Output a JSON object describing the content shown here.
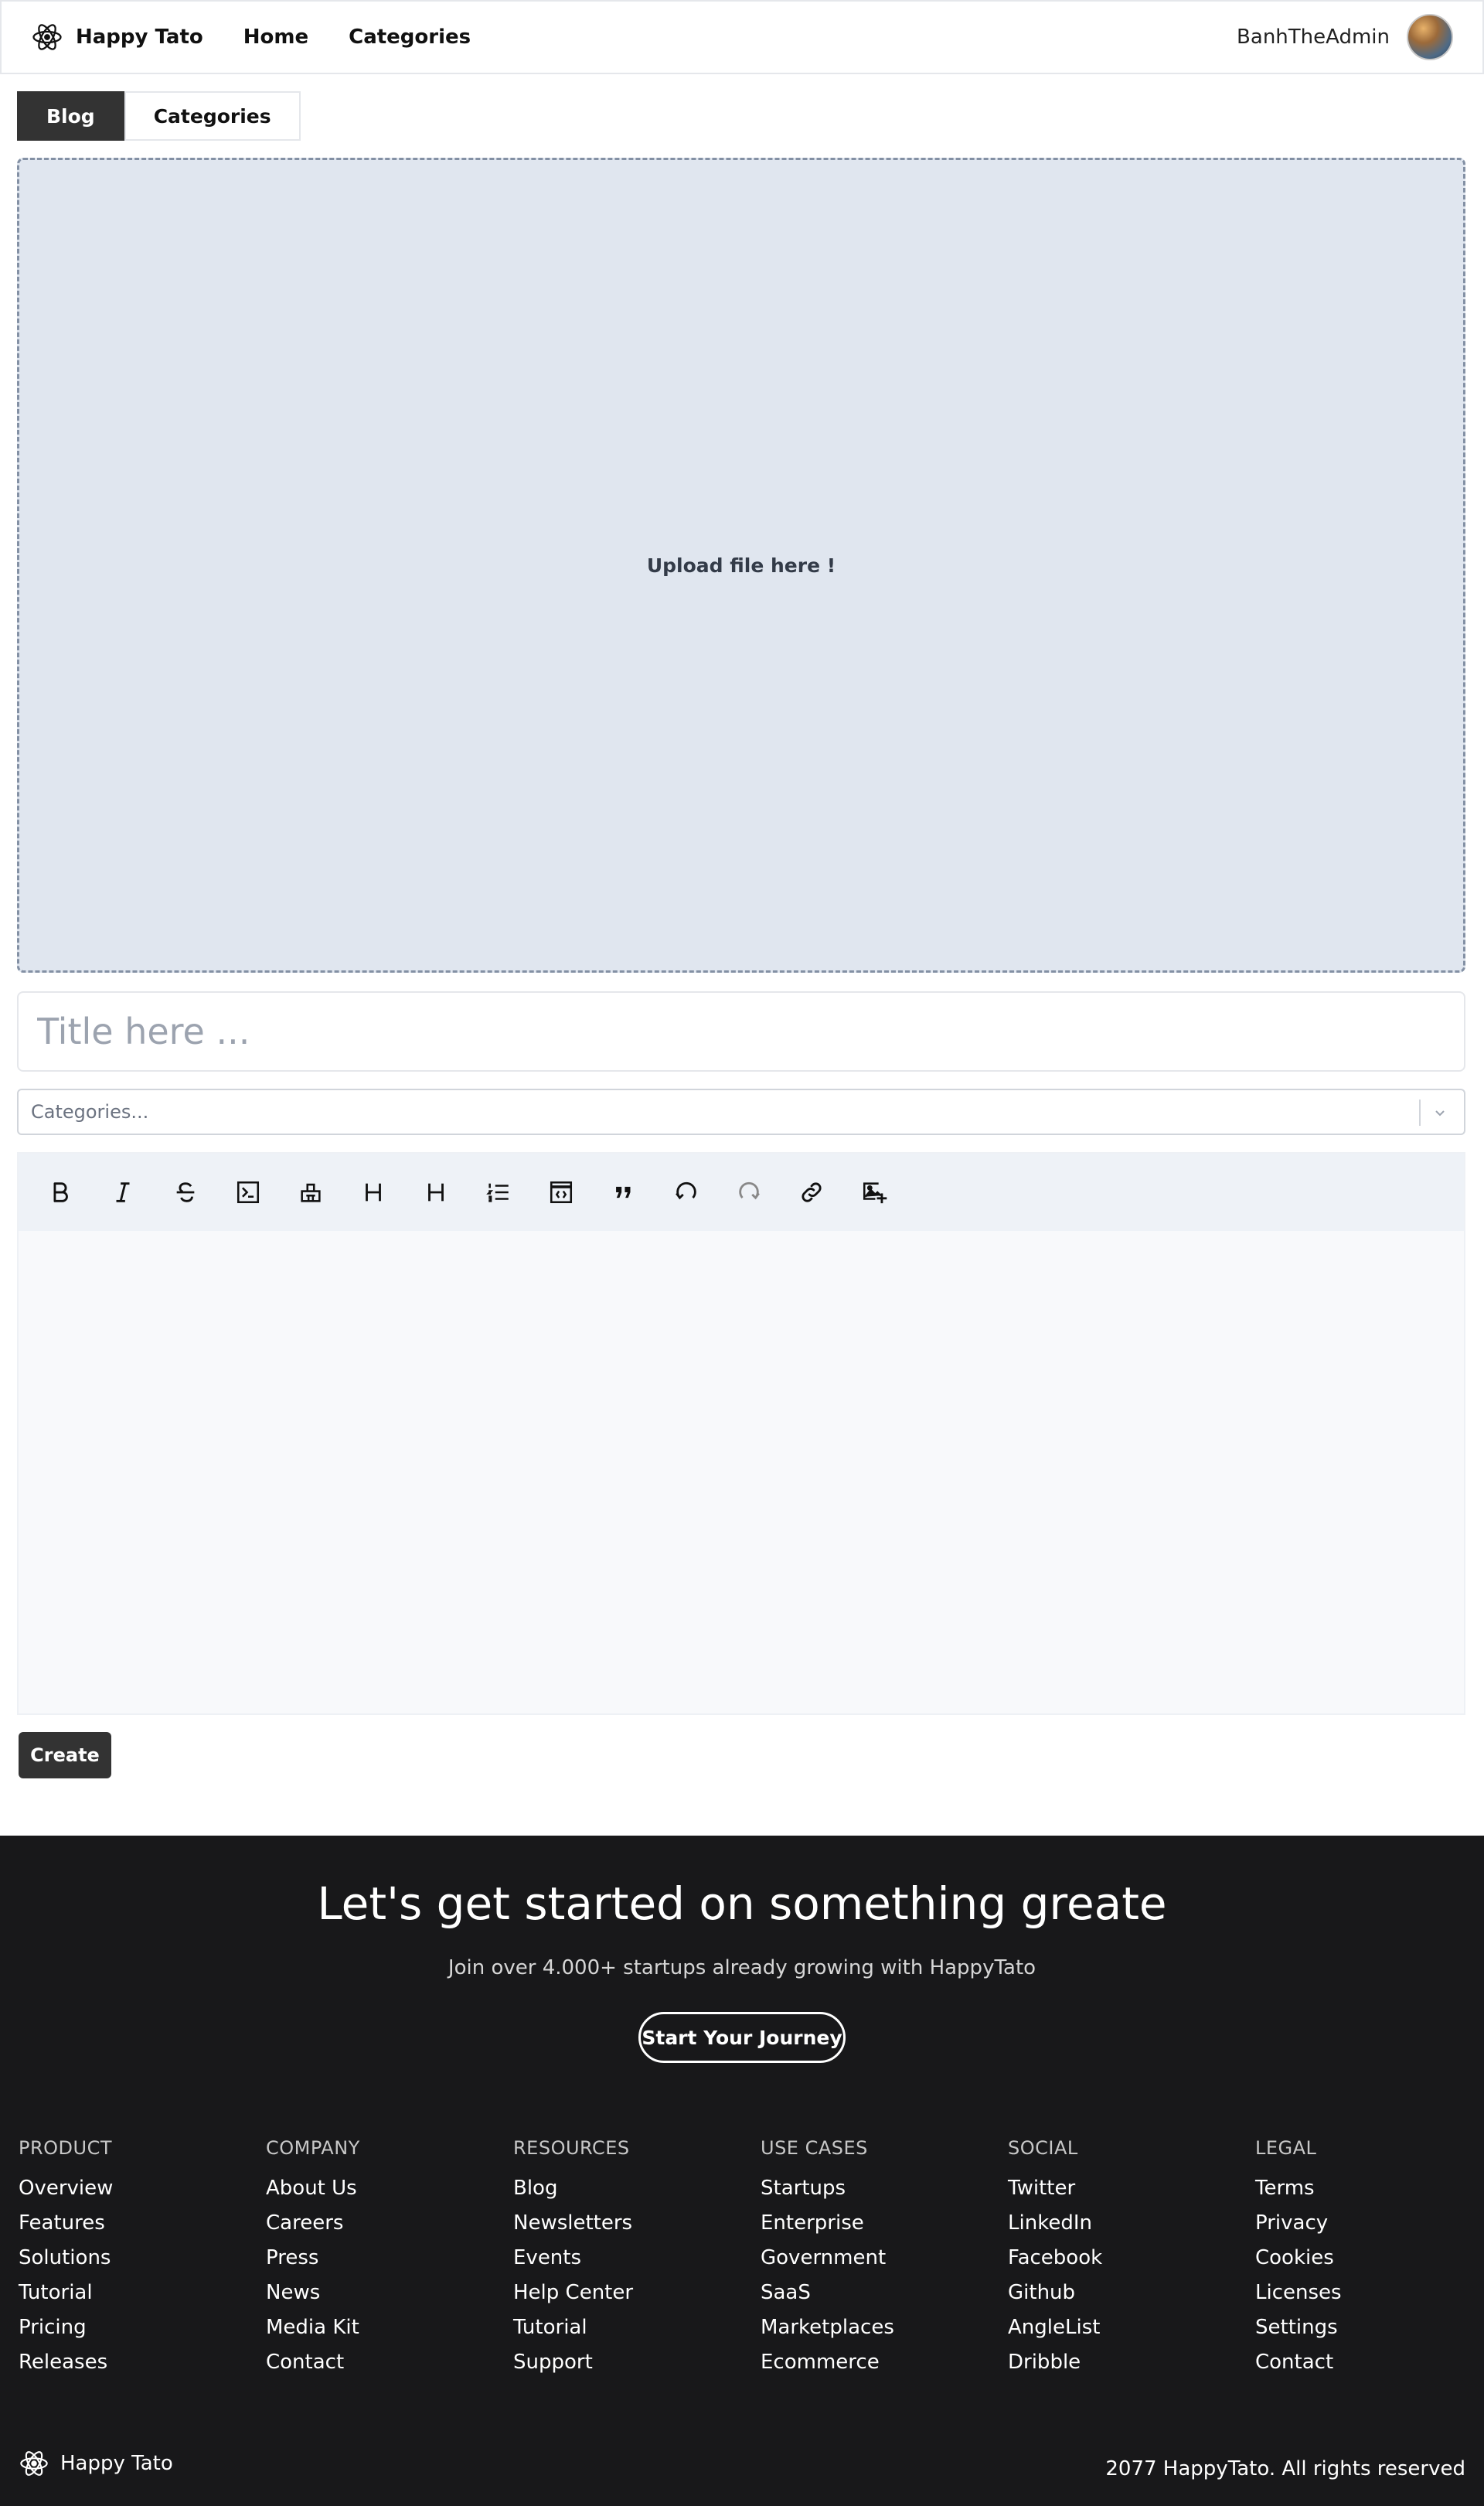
{
  "header": {
    "brand": "Happy Tato",
    "nav": [
      "Home",
      "Categories"
    ],
    "username": "BanhTheAdmin"
  },
  "tabs": [
    {
      "label": "Blog",
      "active": true
    },
    {
      "label": "Categories",
      "active": false
    }
  ],
  "upload": {
    "text": "Upload file here !"
  },
  "title_input": {
    "placeholder": "Title here ...",
    "value": ""
  },
  "categories_select": {
    "placeholder": "Categories..."
  },
  "toolbar": {
    "icons": [
      "bold-icon",
      "italic-icon",
      "strikethrough-icon",
      "code-icon",
      "clear-format-icon",
      "heading-1-icon",
      "heading-2-icon",
      "ordered-list-icon",
      "code-block-icon",
      "quote-icon",
      "undo-icon",
      "redo-icon",
      "link-icon",
      "add-image-icon"
    ]
  },
  "create_button": "Create",
  "footer": {
    "cta_title": "Let's get started on something greate",
    "cta_subtitle": "Join over 4.000+ startups already growing with HappyTato",
    "cta_button": "Start Your Journey",
    "columns": [
      {
        "heading": "PRODUCT",
        "links": [
          "Overview",
          "Features",
          "Solutions",
          "Tutorial",
          "Pricing",
          "Releases"
        ]
      },
      {
        "heading": "COMPANY",
        "links": [
          "About Us",
          "Careers",
          "Press",
          "News",
          "Media Kit",
          "Contact"
        ]
      },
      {
        "heading": "RESOURCES",
        "links": [
          "Blog",
          "Newsletters",
          "Events",
          "Help Center",
          "Tutorial",
          "Support"
        ]
      },
      {
        "heading": "USE CASES",
        "links": [
          "Startups",
          "Enterprise",
          "Government",
          "SaaS",
          "Marketplaces",
          "Ecommerce"
        ]
      },
      {
        "heading": "SOCIAL",
        "links": [
          "Twitter",
          "LinkedIn",
          "Facebook",
          "Github",
          "AngleList",
          "Dribble"
        ]
      },
      {
        "heading": "LEGAL",
        "links": [
          "Terms",
          "Privacy",
          "Cookies",
          "Licenses",
          "Settings",
          "Contact"
        ]
      }
    ],
    "brand": "Happy Tato",
    "copyright": "2077 HappyTato. All rights reserved"
  }
}
